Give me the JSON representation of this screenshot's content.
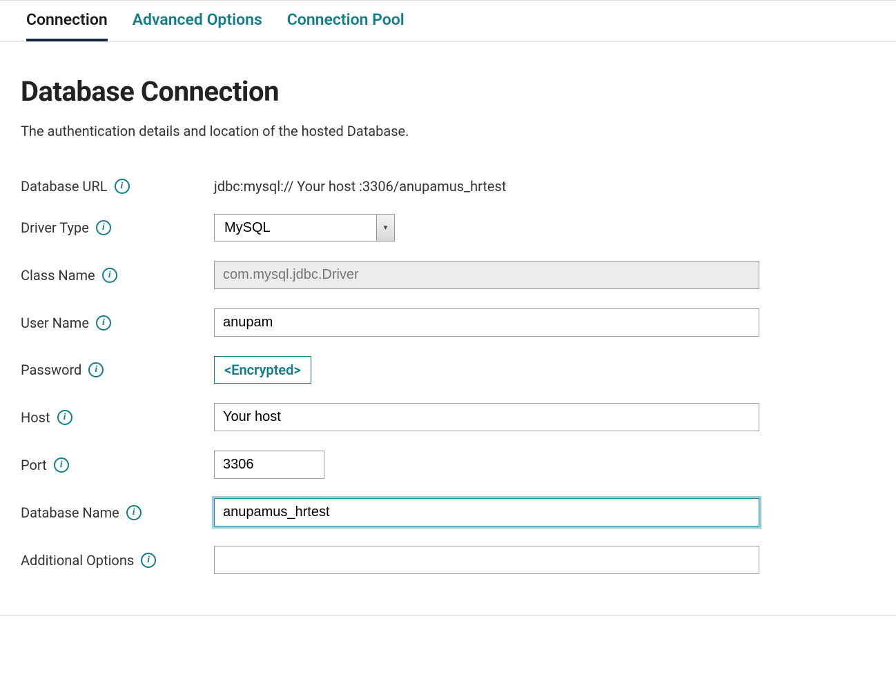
{
  "tabs": [
    {
      "label": "Connection",
      "active": true
    },
    {
      "label": "Advanced Options",
      "active": false
    },
    {
      "label": "Connection Pool",
      "active": false
    }
  ],
  "title": "Database Connection",
  "description": "The authentication details and location of the hosted Database.",
  "fields": {
    "database_url": {
      "label": "Database URL",
      "value": "jdbc:mysql://   Your host   :3306/anupamus_hrtest"
    },
    "driver_type": {
      "label": "Driver Type",
      "value": "MySQL"
    },
    "class_name": {
      "label": "Class Name",
      "value": "com.mysql.jdbc.Driver"
    },
    "user_name": {
      "label": "User Name",
      "value": "anupam"
    },
    "password": {
      "label": "Password",
      "value": "<Encrypted>"
    },
    "host": {
      "label": "Host",
      "value": "Your host"
    },
    "port": {
      "label": "Port",
      "value": "3306"
    },
    "database_name": {
      "label": "Database Name",
      "value": "anupamus_hrtest"
    },
    "additional": {
      "label": "Additional Options",
      "value": ""
    }
  }
}
